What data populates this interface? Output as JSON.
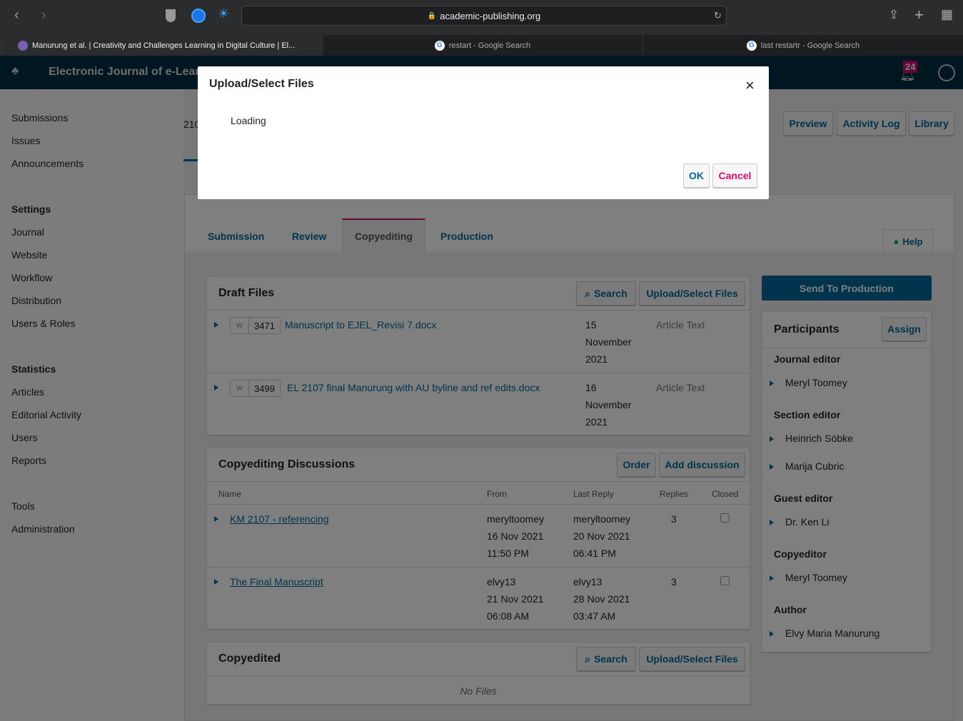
{
  "browser": {
    "url": "academic-publishing.org",
    "tabs": [
      {
        "title": "Manurung et al. | Creativity and Challenges Learning in Digital Culture | El..."
      },
      {
        "title": "restart - Google Search"
      },
      {
        "title": "last restartr - Google Search"
      }
    ]
  },
  "header": {
    "journal": "Electronic Journal of e-Learning",
    "notifications": "24"
  },
  "sidebar": {
    "items": [
      "Submissions",
      "Issues",
      "Announcements"
    ],
    "settings_heading": "Settings",
    "settings": [
      "Journal",
      "Website",
      "Workflow",
      "Distribution",
      "Users & Roles"
    ],
    "statistics_heading": "Statistics",
    "statistics": [
      "Articles",
      "Editorial Activity",
      "Users",
      "Reports"
    ],
    "other": [
      "Tools",
      "Administration"
    ]
  },
  "main": {
    "submission_id_partial": "210",
    "top_buttons": [
      "Preview",
      "Activity Log",
      "Library"
    ],
    "stage_tabs": [
      "Submission",
      "Review",
      "Copyediting",
      "Production"
    ],
    "active_tab": "Copyediting",
    "help": "Help",
    "draft_files": {
      "title": "Draft Files",
      "search": "Search",
      "upload": "Upload/Select Files",
      "files": [
        {
          "id": "3471",
          "name": "Manuscript to EJEL_Revisi 7.docx",
          "date": [
            "15",
            "November",
            "2021"
          ],
          "type": "Article Text"
        },
        {
          "id": "3499",
          "name": "EL 2107 final Manurung with AU byline and ref edits.docx",
          "date": [
            "16",
            "November",
            "2021"
          ],
          "type": "Article Text"
        }
      ]
    },
    "discussions": {
      "title": "Copyediting Discussions",
      "order": "Order",
      "add": "Add discussion",
      "columns": [
        "Name",
        "From",
        "Last Reply",
        "Replies",
        "Closed"
      ],
      "rows": [
        {
          "name": "KM 2107 - referencing",
          "from": [
            "meryltoomey",
            "16 Nov 2021",
            "11:50 PM"
          ],
          "last": [
            "meryltoomey",
            "20 Nov 2021",
            "06:41 PM"
          ],
          "replies": "3",
          "closed": false
        },
        {
          "name": "The Final Manuscript",
          "from": [
            "elvy13",
            "21 Nov 2021",
            "06:08 AM"
          ],
          "last": [
            "elvy13",
            "28 Nov 2021",
            "03:47 AM"
          ],
          "replies": "3",
          "closed": false
        }
      ]
    },
    "copyedited": {
      "title": "Copyedited",
      "search": "Search",
      "upload": "Upload/Select Files",
      "empty": "No Files"
    },
    "send": "Send To Production",
    "participants": {
      "title": "Participants",
      "assign": "Assign",
      "groups": [
        {
          "role": "Journal editor",
          "people": [
            "Meryl Toomey"
          ]
        },
        {
          "role": "Section editor",
          "people": [
            "Heinrich Söbke",
            "Marija Cubric"
          ]
        },
        {
          "role": "Guest editor",
          "people": [
            "Dr. Ken Li"
          ]
        },
        {
          "role": "Copyeditor",
          "people": [
            "Meryl Toomey"
          ]
        },
        {
          "role": "Author",
          "people": [
            "Elvy Maria Manurung"
          ]
        }
      ]
    }
  },
  "modal": {
    "title": "Upload/Select Files",
    "body": "Loading",
    "ok": "OK",
    "cancel": "Cancel"
  },
  "colors": {
    "primary": "#006798",
    "header": "#002c40",
    "cancel": "#d00a6c",
    "badge": "#d00a6c"
  }
}
